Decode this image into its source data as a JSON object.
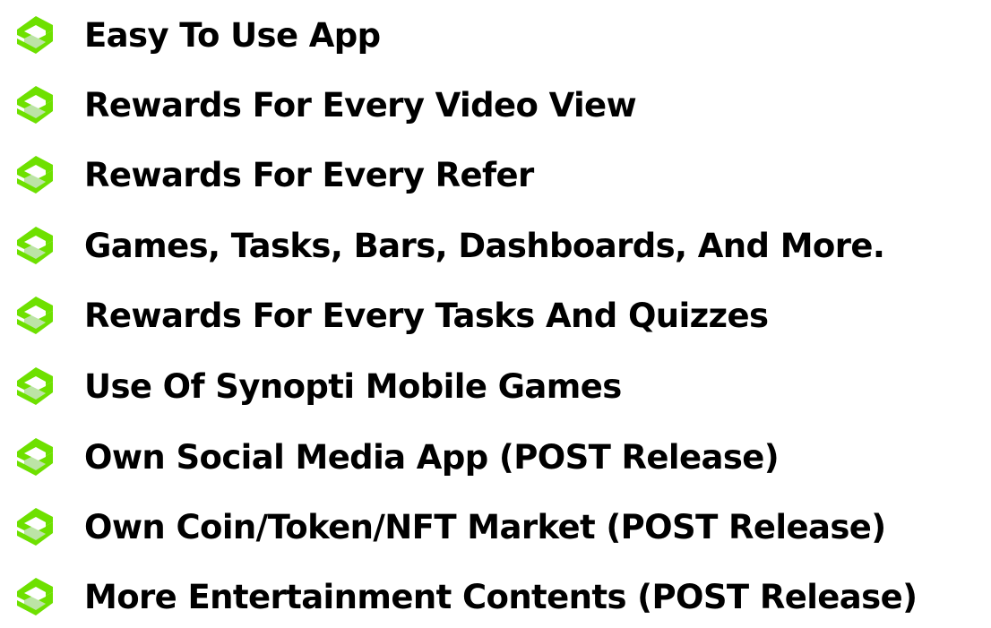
{
  "colors": {
    "bullet": "#6ee000",
    "bullet_dark": "#3fb300",
    "text": "#000000",
    "background": "#ffffff"
  },
  "bullet_icon": "green-s-shape-icon",
  "features": [
    {
      "label": "Easy To Use App"
    },
    {
      "label": "Rewards For Every Video View"
    },
    {
      "label": "Rewards For Every Refer"
    },
    {
      "label": "Games, Tasks, Bars, Dashboards, And More."
    },
    {
      "label": "Rewards For Every Tasks And Quizzes"
    },
    {
      "label": "Use Of Synopti Mobile Games"
    },
    {
      "label": "Own Social Media App (POST Release)"
    },
    {
      "label": "Own Coin/Token/NFT Market (POST Release)"
    },
    {
      "label": "More Entertainment Contents (POST Release)"
    }
  ]
}
